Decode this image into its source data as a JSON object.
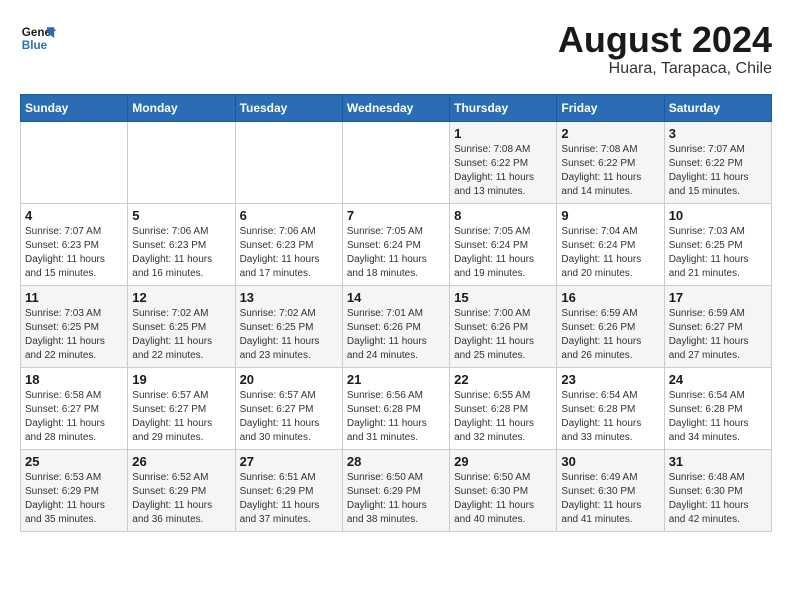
{
  "header": {
    "logo_line1": "General",
    "logo_line2": "Blue",
    "title": "August 2024",
    "subtitle": "Huara, Tarapaca, Chile"
  },
  "days_of_week": [
    "Sunday",
    "Monday",
    "Tuesday",
    "Wednesday",
    "Thursday",
    "Friday",
    "Saturday"
  ],
  "weeks": [
    [
      {
        "day": "",
        "info": ""
      },
      {
        "day": "",
        "info": ""
      },
      {
        "day": "",
        "info": ""
      },
      {
        "day": "",
        "info": ""
      },
      {
        "day": "1",
        "info": "Sunrise: 7:08 AM\nSunset: 6:22 PM\nDaylight: 11 hours and 13 minutes."
      },
      {
        "day": "2",
        "info": "Sunrise: 7:08 AM\nSunset: 6:22 PM\nDaylight: 11 hours and 14 minutes."
      },
      {
        "day": "3",
        "info": "Sunrise: 7:07 AM\nSunset: 6:22 PM\nDaylight: 11 hours and 15 minutes."
      }
    ],
    [
      {
        "day": "4",
        "info": "Sunrise: 7:07 AM\nSunset: 6:23 PM\nDaylight: 11 hours and 15 minutes."
      },
      {
        "day": "5",
        "info": "Sunrise: 7:06 AM\nSunset: 6:23 PM\nDaylight: 11 hours and 16 minutes."
      },
      {
        "day": "6",
        "info": "Sunrise: 7:06 AM\nSunset: 6:23 PM\nDaylight: 11 hours and 17 minutes."
      },
      {
        "day": "7",
        "info": "Sunrise: 7:05 AM\nSunset: 6:24 PM\nDaylight: 11 hours and 18 minutes."
      },
      {
        "day": "8",
        "info": "Sunrise: 7:05 AM\nSunset: 6:24 PM\nDaylight: 11 hours and 19 minutes."
      },
      {
        "day": "9",
        "info": "Sunrise: 7:04 AM\nSunset: 6:24 PM\nDaylight: 11 hours and 20 minutes."
      },
      {
        "day": "10",
        "info": "Sunrise: 7:03 AM\nSunset: 6:25 PM\nDaylight: 11 hours and 21 minutes."
      }
    ],
    [
      {
        "day": "11",
        "info": "Sunrise: 7:03 AM\nSunset: 6:25 PM\nDaylight: 11 hours and 22 minutes."
      },
      {
        "day": "12",
        "info": "Sunrise: 7:02 AM\nSunset: 6:25 PM\nDaylight: 11 hours and 22 minutes."
      },
      {
        "day": "13",
        "info": "Sunrise: 7:02 AM\nSunset: 6:25 PM\nDaylight: 11 hours and 23 minutes."
      },
      {
        "day": "14",
        "info": "Sunrise: 7:01 AM\nSunset: 6:26 PM\nDaylight: 11 hours and 24 minutes."
      },
      {
        "day": "15",
        "info": "Sunrise: 7:00 AM\nSunset: 6:26 PM\nDaylight: 11 hours and 25 minutes."
      },
      {
        "day": "16",
        "info": "Sunrise: 6:59 AM\nSunset: 6:26 PM\nDaylight: 11 hours and 26 minutes."
      },
      {
        "day": "17",
        "info": "Sunrise: 6:59 AM\nSunset: 6:27 PM\nDaylight: 11 hours and 27 minutes."
      }
    ],
    [
      {
        "day": "18",
        "info": "Sunrise: 6:58 AM\nSunset: 6:27 PM\nDaylight: 11 hours and 28 minutes."
      },
      {
        "day": "19",
        "info": "Sunrise: 6:57 AM\nSunset: 6:27 PM\nDaylight: 11 hours and 29 minutes."
      },
      {
        "day": "20",
        "info": "Sunrise: 6:57 AM\nSunset: 6:27 PM\nDaylight: 11 hours and 30 minutes."
      },
      {
        "day": "21",
        "info": "Sunrise: 6:56 AM\nSunset: 6:28 PM\nDaylight: 11 hours and 31 minutes."
      },
      {
        "day": "22",
        "info": "Sunrise: 6:55 AM\nSunset: 6:28 PM\nDaylight: 11 hours and 32 minutes."
      },
      {
        "day": "23",
        "info": "Sunrise: 6:54 AM\nSunset: 6:28 PM\nDaylight: 11 hours and 33 minutes."
      },
      {
        "day": "24",
        "info": "Sunrise: 6:54 AM\nSunset: 6:28 PM\nDaylight: 11 hours and 34 minutes."
      }
    ],
    [
      {
        "day": "25",
        "info": "Sunrise: 6:53 AM\nSunset: 6:29 PM\nDaylight: 11 hours and 35 minutes."
      },
      {
        "day": "26",
        "info": "Sunrise: 6:52 AM\nSunset: 6:29 PM\nDaylight: 11 hours and 36 minutes."
      },
      {
        "day": "27",
        "info": "Sunrise: 6:51 AM\nSunset: 6:29 PM\nDaylight: 11 hours and 37 minutes."
      },
      {
        "day": "28",
        "info": "Sunrise: 6:50 AM\nSunset: 6:29 PM\nDaylight: 11 hours and 38 minutes."
      },
      {
        "day": "29",
        "info": "Sunrise: 6:50 AM\nSunset: 6:30 PM\nDaylight: 11 hours and 40 minutes."
      },
      {
        "day": "30",
        "info": "Sunrise: 6:49 AM\nSunset: 6:30 PM\nDaylight: 11 hours and 41 minutes."
      },
      {
        "day": "31",
        "info": "Sunrise: 6:48 AM\nSunset: 6:30 PM\nDaylight: 11 hours and 42 minutes."
      }
    ]
  ]
}
